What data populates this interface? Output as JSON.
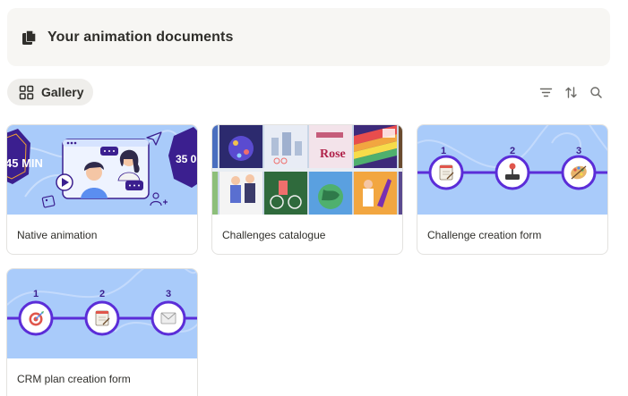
{
  "header": {
    "title": "Your animation documents",
    "icon": "documents-icon"
  },
  "toolbar": {
    "view_label": "Gallery",
    "view_icon": "gallery-grid-icon",
    "tools": [
      "filter-icon",
      "sort-icon",
      "search-icon"
    ]
  },
  "cards": [
    {
      "title": "Native animation",
      "cover": "native-animation-cover",
      "badge_left": "45 MIN",
      "badge_right": "35 0"
    },
    {
      "title": "Challenges catalogue",
      "cover": "challenges-catalogue-cover",
      "poster_text": "Rose"
    },
    {
      "title": "Challenge creation form",
      "cover": "challenge-form-cover",
      "steps": [
        "1",
        "2",
        "3"
      ]
    },
    {
      "title": "CRM plan creation form",
      "cover": "crm-form-cover",
      "steps": [
        "1",
        "2",
        "3"
      ]
    }
  ],
  "colors": {
    "cover_blue": "#a9cbfa",
    "purple": "#5b2dd8",
    "header_bg": "#f7f6f3"
  }
}
